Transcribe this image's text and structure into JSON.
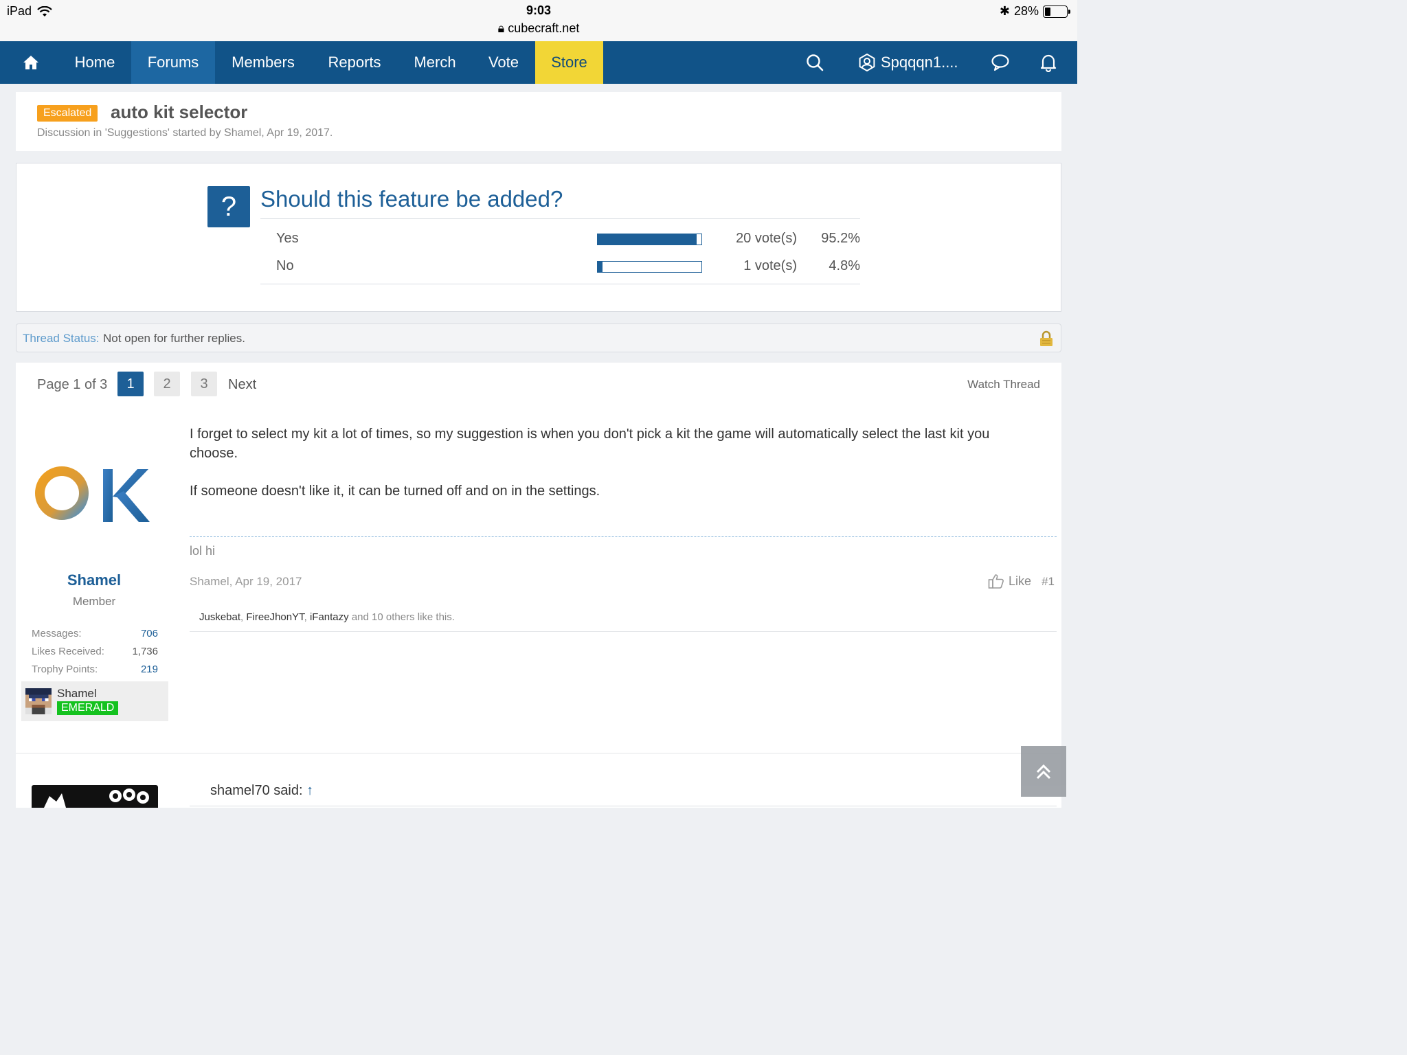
{
  "status_bar": {
    "device": "iPad",
    "time": "9:03",
    "url": "cubecraft.net",
    "battery": "28%"
  },
  "nav": {
    "items": [
      "Home",
      "Forums",
      "Members",
      "Reports",
      "Merch",
      "Vote",
      "Store"
    ],
    "user": "Spqqqn1...."
  },
  "thread": {
    "prefix": "Escalated",
    "title": "auto kit selector",
    "meta": "Discussion in 'Suggestions' started by Shamel, Apr 19, 2017."
  },
  "poll": {
    "question": "Should this feature be added?",
    "options": [
      {
        "label": "Yes",
        "votes": "20 vote(s)",
        "percent": "95.2%",
        "fraction": 0.952
      },
      {
        "label": "No",
        "votes": "1 vote(s)",
        "percent": "4.8%",
        "fraction": 0.048
      }
    ]
  },
  "thread_status": {
    "label": "Thread Status:",
    "value": "Not open for further replies."
  },
  "pagination": {
    "label": "Page 1 of 3",
    "pages": [
      "1",
      "2",
      "3"
    ],
    "current": "1",
    "next": "Next"
  },
  "watch_thread": "Watch Thread",
  "post": {
    "author": "Shamel",
    "user_title": "Member",
    "stats": [
      {
        "label": "Messages:",
        "value": "706"
      },
      {
        "label": "Likes Received:",
        "value": "1,736"
      },
      {
        "label": "Trophy Points:",
        "value": "219"
      }
    ],
    "rank": {
      "name": "Shamel",
      "badge": "EMERALD"
    },
    "body": [
      "I forget to select my kit a lot of times, so my suggestion is when you don't pick a kit the game will automatically select the last kit you choose.",
      "If someone doesn't like it, it can be turned off and on in the settings."
    ],
    "signature": "lol hi",
    "date": "Shamel, Apr 19, 2017",
    "like_label": "Like",
    "post_number": "#1",
    "likes": {
      "names": [
        "Juskebat",
        "FireeJhonYT",
        "iFantazy"
      ],
      "suffix": "and 10 others like this."
    }
  },
  "next_post": {
    "quote_author": "shamel70 said:",
    "quote_arrow": "↑"
  },
  "colors": {
    "nav_bg": "#115388",
    "nav_active": "#1d67a2",
    "store_bg": "#f2d636",
    "accent": "#1d5f97",
    "escalated": "#f7a01d",
    "emerald": "#15c21f"
  }
}
